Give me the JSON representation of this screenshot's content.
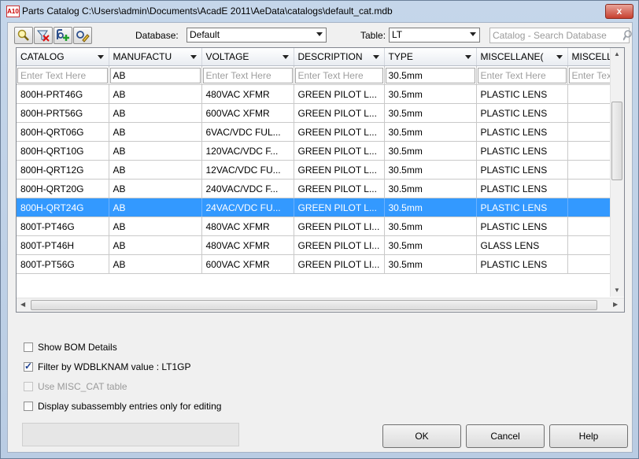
{
  "titlebar": {
    "title": "Parts Catalog C:\\Users\\admin\\Documents\\AcadE 2011\\AeData\\catalogs\\default_cat.mdb",
    "app_icon_text": "A10",
    "close_label": "x"
  },
  "toolbar": {
    "database_label": "Database:",
    "database_value": "Default",
    "table_label": "Table:",
    "table_value": "LT",
    "search_placeholder": "Catalog - Search Database",
    "icons": [
      "find-icon",
      "delete-record-icon",
      "add-record-icon",
      "edit-record-icon"
    ]
  },
  "grid": {
    "columns": [
      "CATALOG",
      "MANUFACTU",
      "VOLTAGE",
      "DESCRIPTION",
      "TYPE",
      "MISCELLANE(",
      "MISCELL"
    ],
    "filter": [
      "Enter Text Here",
      "AB",
      "Enter Text Here",
      "Enter Text Here",
      "30.5mm",
      "Enter Text Here",
      "Enter Text"
    ],
    "rows": [
      [
        "800H-PRT46G",
        "AB",
        "480VAC XFMR",
        "GREEN PILOT L...",
        "30.5mm",
        "PLASTIC LENS",
        ""
      ],
      [
        "800H-PRT56G",
        "AB",
        "600VAC XFMR",
        "GREEN PILOT L...",
        "30.5mm",
        "PLASTIC LENS",
        ""
      ],
      [
        "800H-QRT06G",
        "AB",
        "6VAC/VDC FUL...",
        "GREEN PILOT L...",
        "30.5mm",
        "PLASTIC LENS",
        ""
      ],
      [
        "800H-QRT10G",
        "AB",
        "120VAC/VDC F...",
        "GREEN PILOT L...",
        "30.5mm",
        "PLASTIC LENS",
        ""
      ],
      [
        "800H-QRT12G",
        "AB",
        "12VAC/VDC FU...",
        "GREEN PILOT L...",
        "30.5mm",
        "PLASTIC LENS",
        ""
      ],
      [
        "800H-QRT20G",
        "AB",
        "240VAC/VDC F...",
        "GREEN PILOT L...",
        "30.5mm",
        "PLASTIC LENS",
        ""
      ],
      [
        "800H-QRT24G",
        "AB",
        "24VAC/VDC FU...",
        "GREEN PILOT L...",
        "30.5mm",
        "PLASTIC LENS",
        ""
      ],
      [
        "800T-PT46G",
        "AB",
        "480VAC XFMR",
        "GREEN PILOT LI...",
        "30.5mm",
        "PLASTIC LENS",
        ""
      ],
      [
        "800T-PT46H",
        "AB",
        "480VAC XFMR",
        "GREEN PILOT LI...",
        "30.5mm",
        "GLASS LENS",
        ""
      ],
      [
        "800T-PT56G",
        "AB",
        "600VAC XFMR",
        "GREEN PILOT LI...",
        "30.5mm",
        "PLASTIC LENS",
        ""
      ]
    ],
    "selected_row": 6,
    "selection_color": "#3399ff"
  },
  "options": {
    "show_bom": "Show BOM Details",
    "filter_wdblknam": "Filter by WDBLKNAM value : LT1GP",
    "use_misc_cat": "Use MISC_CAT table",
    "subassembly": "Display subassembly entries only for editing"
  },
  "buttons": {
    "ok": "OK",
    "cancel": "Cancel",
    "help": "Help"
  }
}
